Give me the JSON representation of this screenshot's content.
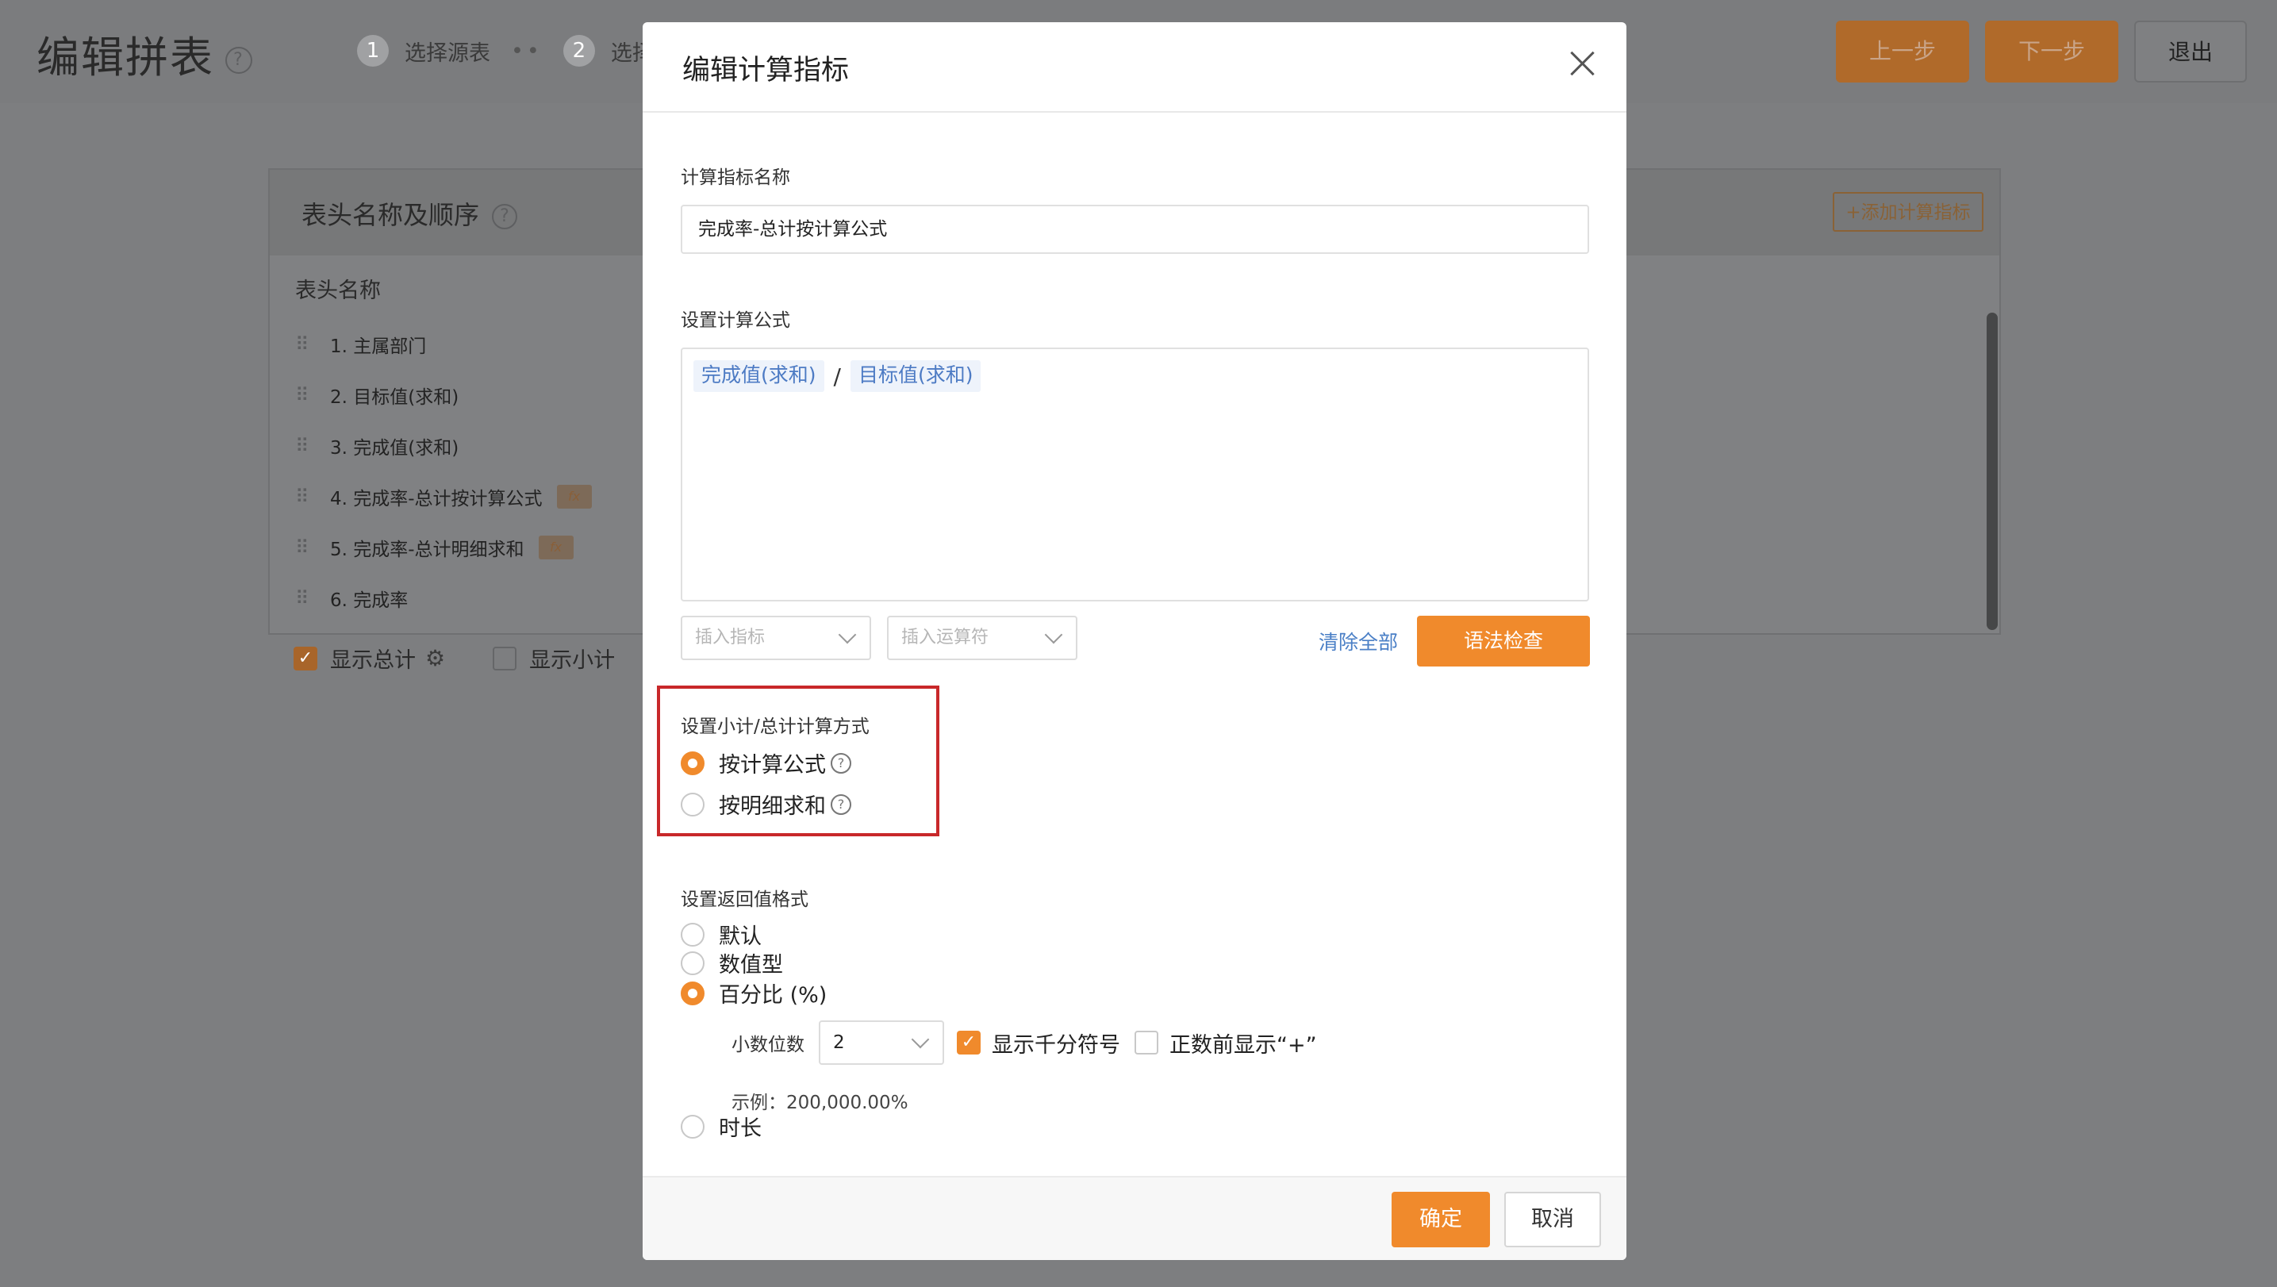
{
  "page": {
    "title": "编辑拼表",
    "help_icon": "?",
    "steps": [
      {
        "num": "1",
        "label": "选择源表"
      },
      {
        "num": "2",
        "label": "选择"
      }
    ],
    "prev_button": "上一步",
    "next_button": "下一步",
    "exit_button": "退出"
  },
  "panel": {
    "title": "表头名称及顺序",
    "add_metric_button": "+添加计算指标",
    "column_header": "表头名称",
    "rows": [
      {
        "label": "1. 主属部门",
        "fx": ""
      },
      {
        "label": "2. 目标值(求和)",
        "fx": ""
      },
      {
        "label": "3. 完成值(求和)",
        "fx": ""
      },
      {
        "label": "4. 完成率-总计按计算公式",
        "fx": "fx"
      },
      {
        "label": "5. 完成率-总计明细求和",
        "fx": "fx"
      },
      {
        "label": "6. 完成率",
        "fx": ""
      }
    ],
    "show_total": "显示总计",
    "show_subtotal": "显示小计"
  },
  "modal": {
    "title": "编辑计算指标",
    "name_label": "计算指标名称",
    "name_value": "完成率-总计按计算公式",
    "formula_label": "设置计算公式",
    "formula": {
      "left": "完成值(求和)",
      "operator": "/",
      "right": "目标值(求和)"
    },
    "insert_metric_placeholder": "插入指标",
    "insert_operator_placeholder": "插入运算符",
    "clear_all": "清除全部",
    "syntax_check": "语法检查",
    "subtotal_label": "设置小计/总计计算方式",
    "subtotal_options": [
      {
        "label": "按计算公式",
        "selected": true
      },
      {
        "label": "按明细求和",
        "selected": false
      }
    ],
    "format_label": "设置返回值格式",
    "format_options": [
      {
        "label": "默认",
        "selected": false
      },
      {
        "label": "数值型",
        "selected": false
      },
      {
        "label": "百分比 (%)",
        "selected": true
      },
      {
        "label": "时长",
        "selected": false
      }
    ],
    "decimal_label": "小数位数",
    "decimal_value": "2",
    "thousands_label": "显示千分符号",
    "thousands_checked": true,
    "plus_label": "正数前显示“+”",
    "plus_checked": false,
    "example": "示例：200,000.00%",
    "ok_button": "确定",
    "cancel_button": "取消"
  },
  "colors": {
    "accent": "#f08a2c",
    "link": "#4a7fc6",
    "highlight_border": "#c8282a"
  }
}
